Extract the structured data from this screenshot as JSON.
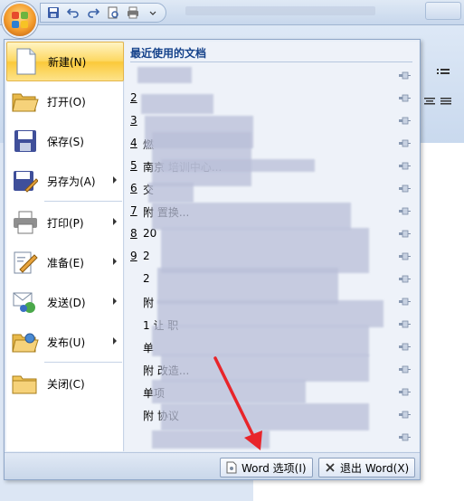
{
  "menu": {
    "items": [
      {
        "label": "新建(N)",
        "icon": "new-document-icon",
        "submenu": false
      },
      {
        "label": "打开(O)",
        "icon": "open-folder-icon",
        "submenu": false
      },
      {
        "label": "保存(S)",
        "icon": "save-disk-icon",
        "submenu": false
      },
      {
        "label": "另存为(A)",
        "icon": "save-as-icon",
        "submenu": true
      },
      {
        "label": "打印(P)",
        "icon": "printer-icon",
        "submenu": true
      },
      {
        "label": "准备(E)",
        "icon": "prepare-pen-icon",
        "submenu": true
      },
      {
        "label": "发送(D)",
        "icon": "send-icon",
        "submenu": true
      },
      {
        "label": "发布(U)",
        "icon": "publish-folder-icon",
        "submenu": true
      },
      {
        "label": "关闭(C)",
        "icon": "close-folder-icon",
        "submenu": false
      }
    ]
  },
  "recent": {
    "title": "最近使用的文档",
    "rows": [
      {
        "num": "",
        "text": ""
      },
      {
        "num": "2",
        "text": ""
      },
      {
        "num": "3",
        "text": ""
      },
      {
        "num": "4",
        "text": "燃"
      },
      {
        "num": "5",
        "text": "                  南京      培训中心..."
      },
      {
        "num": "6",
        "text": "交"
      },
      {
        "num": "7",
        "text": "附                         置换..."
      },
      {
        "num": "8",
        "text": "20"
      },
      {
        "num": "9",
        "text": "2"
      },
      {
        "num": "",
        "text": "2"
      },
      {
        "num": "",
        "text": "附"
      },
      {
        "num": "",
        "text": "1     让                              职"
      },
      {
        "num": "",
        "text": "单"
      },
      {
        "num": "",
        "text": "附                               改造..."
      },
      {
        "num": "",
        "text": "单项"
      },
      {
        "num": "",
        "text": "附                    协议"
      },
      {
        "num": "",
        "text": ""
      }
    ]
  },
  "bottom": {
    "options_label": "Word 选项(I)",
    "exit_label": "退出 Word(X)"
  }
}
